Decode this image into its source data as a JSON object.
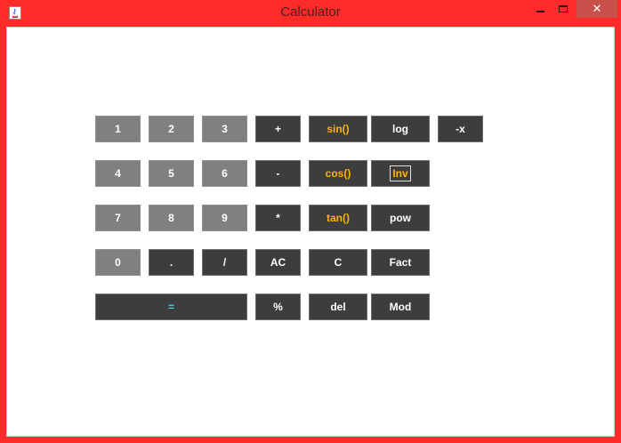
{
  "window": {
    "title": "Calculator",
    "minimize_icon": "minimize-icon",
    "maximize_icon": "maximize-icon",
    "close_icon": "close-icon",
    "close_glyph": "✕",
    "frame_color": "#ff2a2a"
  },
  "keys": {
    "k1": "1",
    "k2": "2",
    "k3": "3",
    "plus": "+",
    "sin": "sin()",
    "log": "log",
    "negate": "-x",
    "k4": "4",
    "k5": "5",
    "k6": "6",
    "minus": "-",
    "cos": "cos()",
    "inv": "Inv",
    "k7": "7",
    "k8": "8",
    "k9": "9",
    "multiply": "*",
    "tan": "tan()",
    "pow": "pow",
    "k0": "0",
    "dot": ".",
    "divide": "/",
    "ac": "AC",
    "c": "C",
    "fact": "Fact",
    "equals": "=",
    "percent": "%",
    "del": "del",
    "mod": "Mod"
  },
  "colors": {
    "digit_key": "#808080",
    "operator_key": "#3d3d3d",
    "trig_text": "#ffb300",
    "equals_text": "#33d6e6"
  }
}
